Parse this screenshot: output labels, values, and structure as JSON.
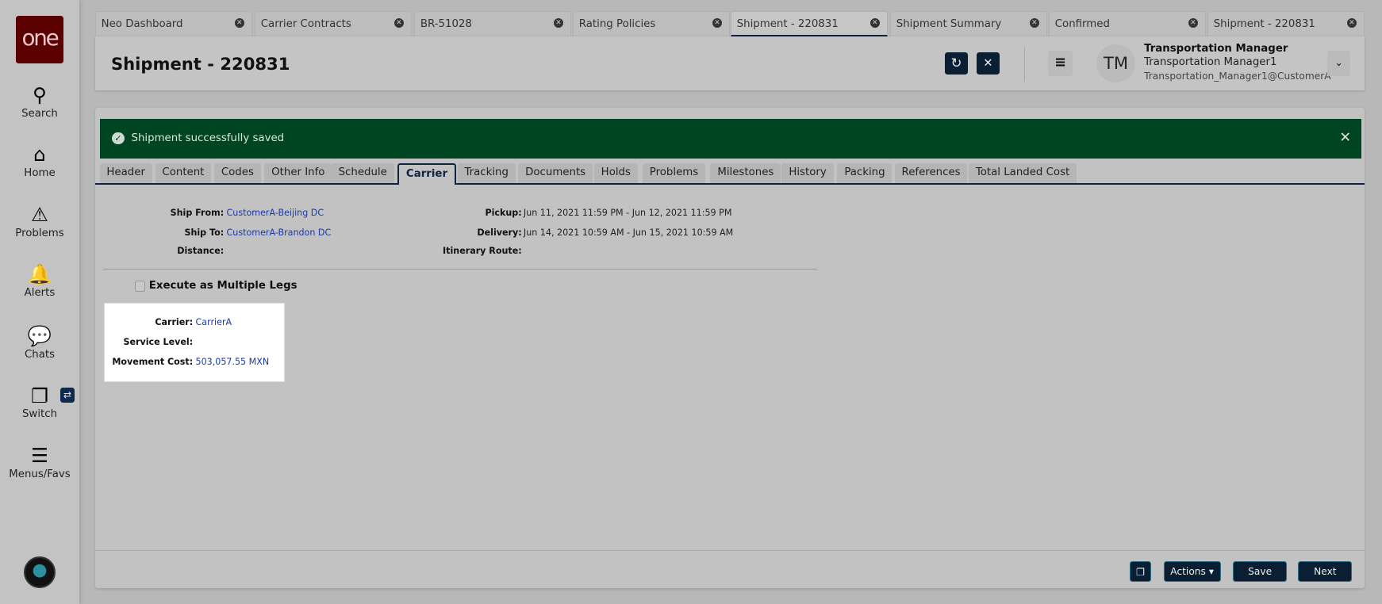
{
  "sidebar": {
    "logo": "one",
    "items": [
      {
        "label": "Search"
      },
      {
        "label": "Home"
      },
      {
        "label": "Problems"
      },
      {
        "label": "Alerts"
      },
      {
        "label": "Chats"
      },
      {
        "label": "Switch"
      },
      {
        "label": "Menus/Favs"
      }
    ]
  },
  "window_tabs": [
    {
      "label": "Neo Dashboard"
    },
    {
      "label": "Carrier Contracts"
    },
    {
      "label": "BR-51028"
    },
    {
      "label": "Rating Policies"
    },
    {
      "label": "Shipment - 220831",
      "active": true
    },
    {
      "label": "Shipment Summary"
    },
    {
      "label": "Confirmed"
    },
    {
      "label": "Shipment - 220831"
    }
  ],
  "header": {
    "title": "Shipment - 220831",
    "user": {
      "initials": "TM",
      "role": "Transportation Manager",
      "name": "Transportation Manager1",
      "login": "Transportation_Manager1@CustomerA"
    }
  },
  "banner": {
    "message": "Shipment successfully saved"
  },
  "sub_tabs": [
    "Header",
    "Content",
    "Codes",
    "Other Info",
    "Schedule",
    "Carrier",
    "Tracking",
    "Documents",
    "Holds",
    "Problems",
    "Milestones",
    "History",
    "Packing",
    "References",
    "Total Landed Cost"
  ],
  "active_sub_tab": "Carrier",
  "details": {
    "ship_from_label": "Ship From:",
    "ship_from": "CustomerA-Beijing DC",
    "ship_to_label": "Ship To:",
    "ship_to": "CustomerA-Brandon DC",
    "distance_label": "Distance:",
    "pickup_label": "Pickup:",
    "pickup": "Jun 11, 2021 11:59 PM - Jun 12, 2021 11:59 PM",
    "delivery_label": "Delivery:",
    "delivery": "Jun 14, 2021 10:59 AM - Jun 15, 2021 10:59 AM",
    "itinerary_label": "Itinerary Route:"
  },
  "execute_multiple_legs": {
    "label": "Execute as Multiple Legs",
    "checked": false
  },
  "carrier_card": {
    "carrier_label": "Carrier:",
    "carrier": "CarrierA",
    "service_level_label": "Service Level:",
    "movement_cost_label": "Movement Cost:",
    "movement_cost": "503,057.55 MXN"
  },
  "footer": {
    "actions": "Actions",
    "save": "Save",
    "next": "Next"
  }
}
